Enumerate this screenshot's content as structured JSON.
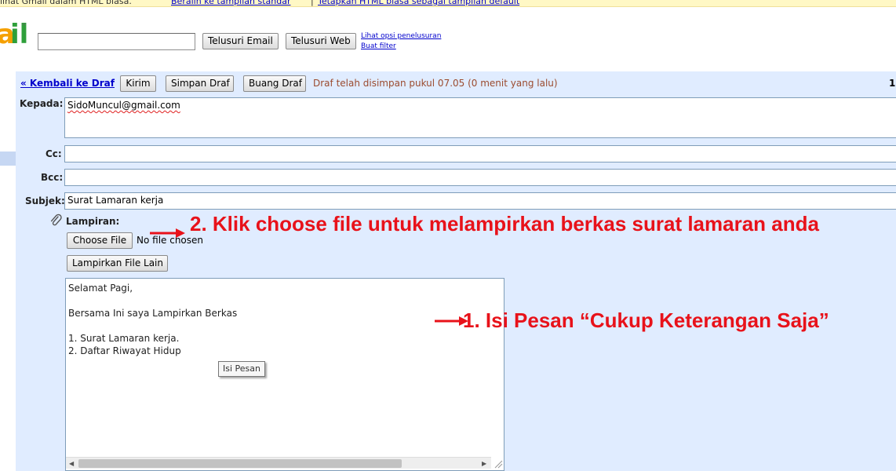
{
  "top_notice": {
    "text": "lihat Gmail dalam HTML biasa.",
    "link_standard": "Beralih ke tampilan standar",
    "separator": "|",
    "link_set_default": "Tetapkan HTML biasa sebagai tampilan default"
  },
  "search": {
    "input_value": "",
    "search_mail_label": "Telusuri Email",
    "search_web_label": "Telusuri Web",
    "options_link": "Lihat opsi penelusuran",
    "create_filter_link": "Buat filter"
  },
  "compose_toolbar": {
    "back_link": "« Kembali ke Draf",
    "send_label": "Kirim",
    "save_draft_label": "Simpan Draf",
    "discard_draft_label": "Buang Draf",
    "status_text": "Draf telah disimpan pukul 07.05 (0 menit yang lalu)",
    "page_indicator": "1"
  },
  "fields": {
    "to_label": "Kepada:",
    "to_value": "SidoMuncul@gmail.com",
    "cc_label": "Cc:",
    "cc_value": "",
    "bcc_label": "Bcc:",
    "bcc_value": "",
    "subject_label": "Subjek:",
    "subject_value": "Surat Lamaran kerja"
  },
  "attachment": {
    "label": "Lampiran:",
    "choose_file_label": "Choose File",
    "no_file_text": "No file chosen",
    "attach_more_label": "Lampirkan File Lain"
  },
  "message_body": {
    "lines": [
      "Selamat Pagi,",
      "Bersama Ini saya Lampirkan Berkas",
      "1. Surat Lamaran kerja.",
      "2. Daftar Riwayat Hidup"
    ],
    "tooltip": "Isi Pesan"
  },
  "annotations": {
    "step2": "2. Klik choose file untuk melampirkan berkas surat lamaran anda",
    "step1": "1. Isi Pesan “Cukup Keterangan Saja”",
    "color": "#e8121a"
  },
  "icons": {
    "attachment": "paperclip-icon",
    "scroll_left": "arrow-left-icon",
    "scroll_right": "arrow-right-icon"
  }
}
